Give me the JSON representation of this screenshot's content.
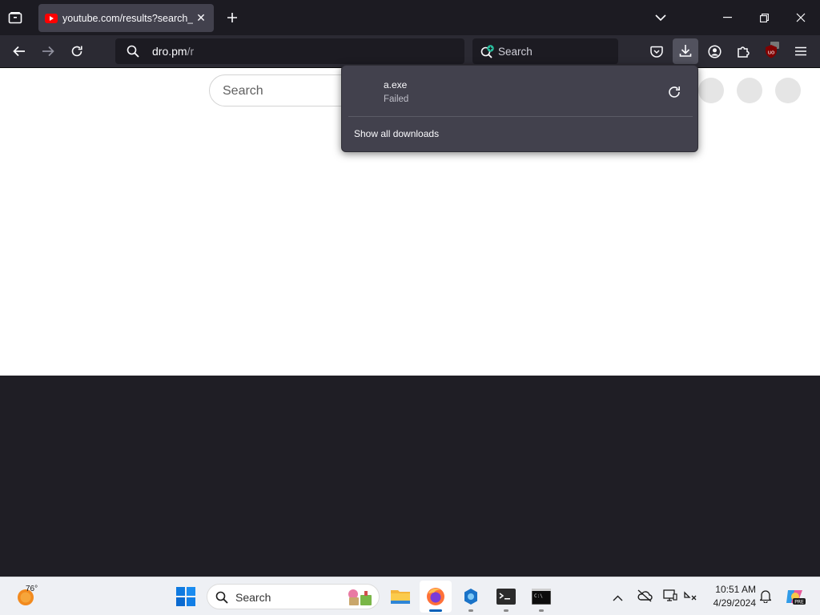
{
  "browser": {
    "tab": {
      "title": "youtube.com/results?search_query"
    },
    "url": {
      "host": "dro.pm",
      "path": "/r"
    },
    "search_placeholder": "Search"
  },
  "downloads": {
    "item": {
      "filename": "a.exe",
      "status": "Failed"
    },
    "show_all": "Show all downloads"
  },
  "page": {
    "search_placeholder": "Search"
  },
  "taskbar": {
    "weather_temp": "76°",
    "search_placeholder": "Search",
    "time": "10:51 AM",
    "date": "4/29/2024"
  },
  "colors": {
    "accent": "#005fb8",
    "firefox_chrome": "#2b2a33",
    "panel": "#42414d"
  }
}
